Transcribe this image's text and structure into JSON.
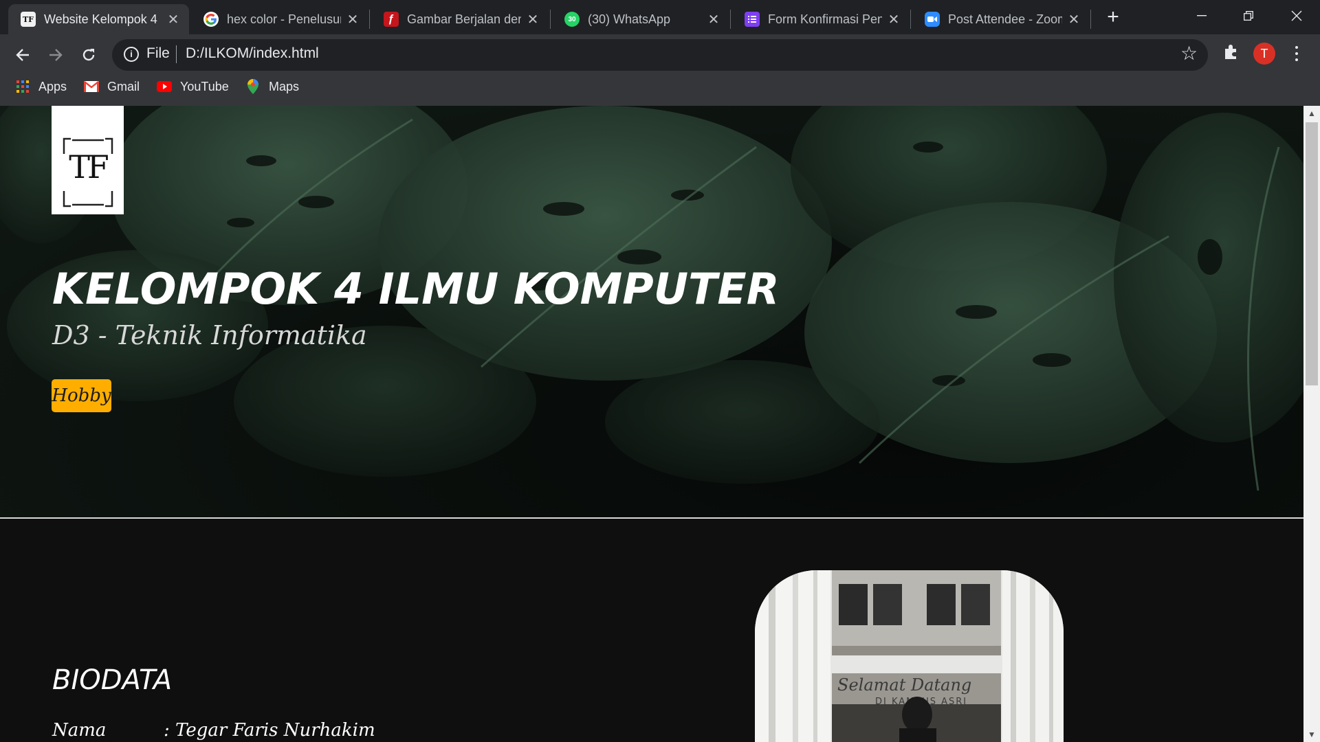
{
  "tabs": [
    {
      "title": "Website Kelompok 4",
      "favicon": "tf-logo-icon",
      "active": true
    },
    {
      "title": "hex color - Penelusuran",
      "favicon": "google-icon"
    },
    {
      "title": "Gambar Berjalan dengan",
      "favicon": "flash-icon"
    },
    {
      "title": "(30) WhatsApp",
      "favicon": "whatsapp-icon",
      "badge": "30"
    },
    {
      "title": "Form Konfirmasi Pendaftaran",
      "favicon": "forms-icon"
    },
    {
      "title": "Post Attendee - Zoom",
      "favicon": "zoom-icon"
    }
  ],
  "tab_favicon_text": {
    "tf": "TF"
  },
  "address_bar": {
    "scheme": "File",
    "url": "D:/ILKOM/index.html"
  },
  "profile": {
    "initial": "T",
    "color": "#d93025"
  },
  "bookmarks": [
    {
      "label": "Apps",
      "icon": "apps-grid-icon"
    },
    {
      "label": "Gmail",
      "icon": "gmail-icon"
    },
    {
      "label": "YouTube",
      "icon": "youtube-icon"
    },
    {
      "label": "Maps",
      "icon": "maps-pin-icon"
    }
  ],
  "page": {
    "logo_text": "TF",
    "hero_title": "KELOMPOK 4 ILMU KOMPUTER",
    "hero_subtitle": "D3 - Teknik Informatika",
    "hobby_button": "Hobby",
    "accent_color": "#ffae00",
    "biodata_title": "BIODATA",
    "biodata": [
      {
        "label": "Nama",
        "value": ": Tegar Faris Nurhakim"
      }
    ],
    "photo_sign_line1": "Selamat Datang",
    "photo_sign_line2": "DI KAMPUS ASRI"
  }
}
